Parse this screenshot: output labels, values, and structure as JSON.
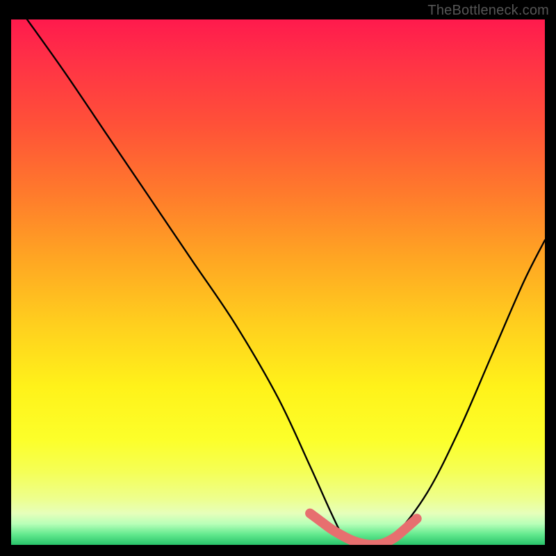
{
  "watermark": "TheBottleneck.com",
  "gradient": {
    "top": "#ff1a4d",
    "mid": "#fff21a",
    "bottom": "#28c36a"
  },
  "chart_data": {
    "type": "line",
    "title": "",
    "xlabel": "",
    "ylabel": "",
    "xlim": [
      0,
      100
    ],
    "ylim": [
      0,
      100
    ],
    "series": [
      {
        "name": "black-curve",
        "color": "#000000",
        "x": [
          3,
          10,
          18,
          26,
          34,
          42,
          50,
          56,
          60,
          62,
          64,
          68,
          72,
          78,
          84,
          90,
          96,
          100
        ],
        "y": [
          100,
          90,
          78,
          66,
          54,
          42,
          28,
          15,
          6,
          2,
          0,
          0,
          2,
          10,
          22,
          36,
          50,
          58
        ]
      },
      {
        "name": "pink-overlay",
        "color": "#e76f6f",
        "x": [
          56,
          58,
          60,
          62,
          64,
          66,
          68,
          70,
          72,
          74,
          76
        ],
        "y": [
          6,
          4.5,
          3,
          1.8,
          0.8,
          0.2,
          0,
          0.4,
          1.5,
          3.2,
          5
        ]
      }
    ]
  }
}
